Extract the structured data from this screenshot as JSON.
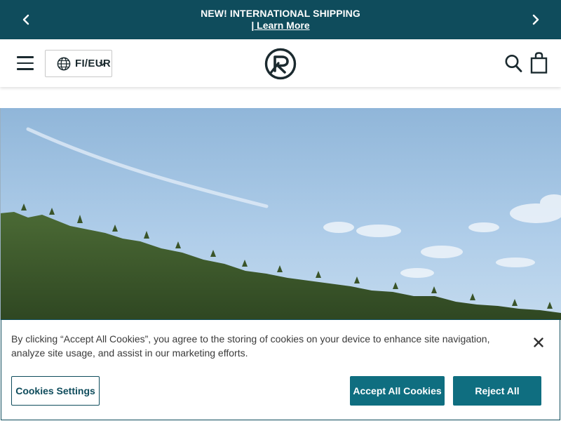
{
  "announcement": {
    "message": "NEW! INTERNATIONAL SHIPPING",
    "link_text": "| Learn More"
  },
  "header": {
    "country_label": "FI/EUR",
    "icons": {
      "menu": "hamburger-icon",
      "globe": "globe-icon",
      "chevron": "chevron-down-icon",
      "logo": "brand-logo",
      "search": "search-icon",
      "bag": "shopping-bag-icon"
    }
  },
  "hero": {
    "description": "",
    "sky_color": "#a9c9e6",
    "forest_color": "#3e5a2c"
  },
  "cookie_banner": {
    "text": "By clicking “Accept All Cookies”, you agree to the storing of cookies on your device to enhance site navigation, analyze site usage, and assist in our marketing efforts.",
    "settings_label": "Cookies Settings",
    "accept_label": "Accept All Cookies",
    "reject_label": "Reject All"
  },
  "colors": {
    "brand_teal": "#0f4c5c",
    "button_teal": "#0f6e80",
    "text_dark": "#1b2a2f"
  }
}
